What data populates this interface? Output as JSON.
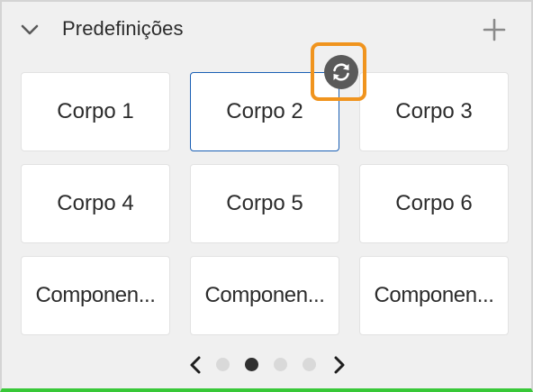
{
  "panel": {
    "title": "Predefinições",
    "accent_color": "#f0941e",
    "selected_border_color": "#1a5fb4"
  },
  "tiles": [
    {
      "label": "Corpo 1",
      "selected": false
    },
    {
      "label": "Corpo 2",
      "selected": true
    },
    {
      "label": "Corpo 3",
      "selected": false
    },
    {
      "label": "Corpo 4",
      "selected": false
    },
    {
      "label": "Corpo 5",
      "selected": false
    },
    {
      "label": "Corpo 6",
      "selected": false
    },
    {
      "label": "Componen...",
      "selected": false
    },
    {
      "label": "Componen...",
      "selected": false
    },
    {
      "label": "Componen...",
      "selected": false
    }
  ],
  "pagination": {
    "page_count": 4,
    "current_page": 2
  },
  "icons": {
    "collapse": "chevron-down-icon",
    "add": "plus-icon",
    "refresh": "refresh-icon",
    "prev": "chevron-left-icon",
    "next": "chevron-right-icon"
  }
}
